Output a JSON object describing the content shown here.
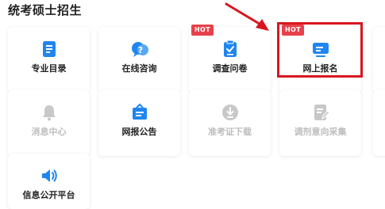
{
  "section_title": "统考硕士招生",
  "hot_badge": "HOT",
  "tiles": [
    {
      "label": "专业目录",
      "icon": "document-list-icon",
      "enabled": true
    },
    {
      "label": "在线咨询",
      "icon": "chat-question-icon",
      "enabled": true
    },
    {
      "label": "调查问卷",
      "icon": "clipboard-check-icon",
      "enabled": true,
      "hot": true
    },
    {
      "label": "网上报名",
      "icon": "monitor-icon",
      "enabled": true,
      "hot": true,
      "highlighted": true
    },
    {
      "label": "消息中心",
      "icon": "bell-icon",
      "enabled": false
    },
    {
      "label": "网报公告",
      "icon": "announcement-box-icon",
      "enabled": true
    },
    {
      "label": "准考证下载",
      "icon": "download-circle-icon",
      "enabled": false
    },
    {
      "label": "调剂意向采集",
      "icon": "edit-document-icon",
      "enabled": false
    },
    {
      "label": "信息公开平台",
      "icon": "speaker-icon",
      "enabled": true
    }
  ],
  "colors": {
    "accent": "#1f86f0",
    "disabled": "#c8c8c8",
    "hot": "#e7414b",
    "highlight": "#d8161f"
  }
}
